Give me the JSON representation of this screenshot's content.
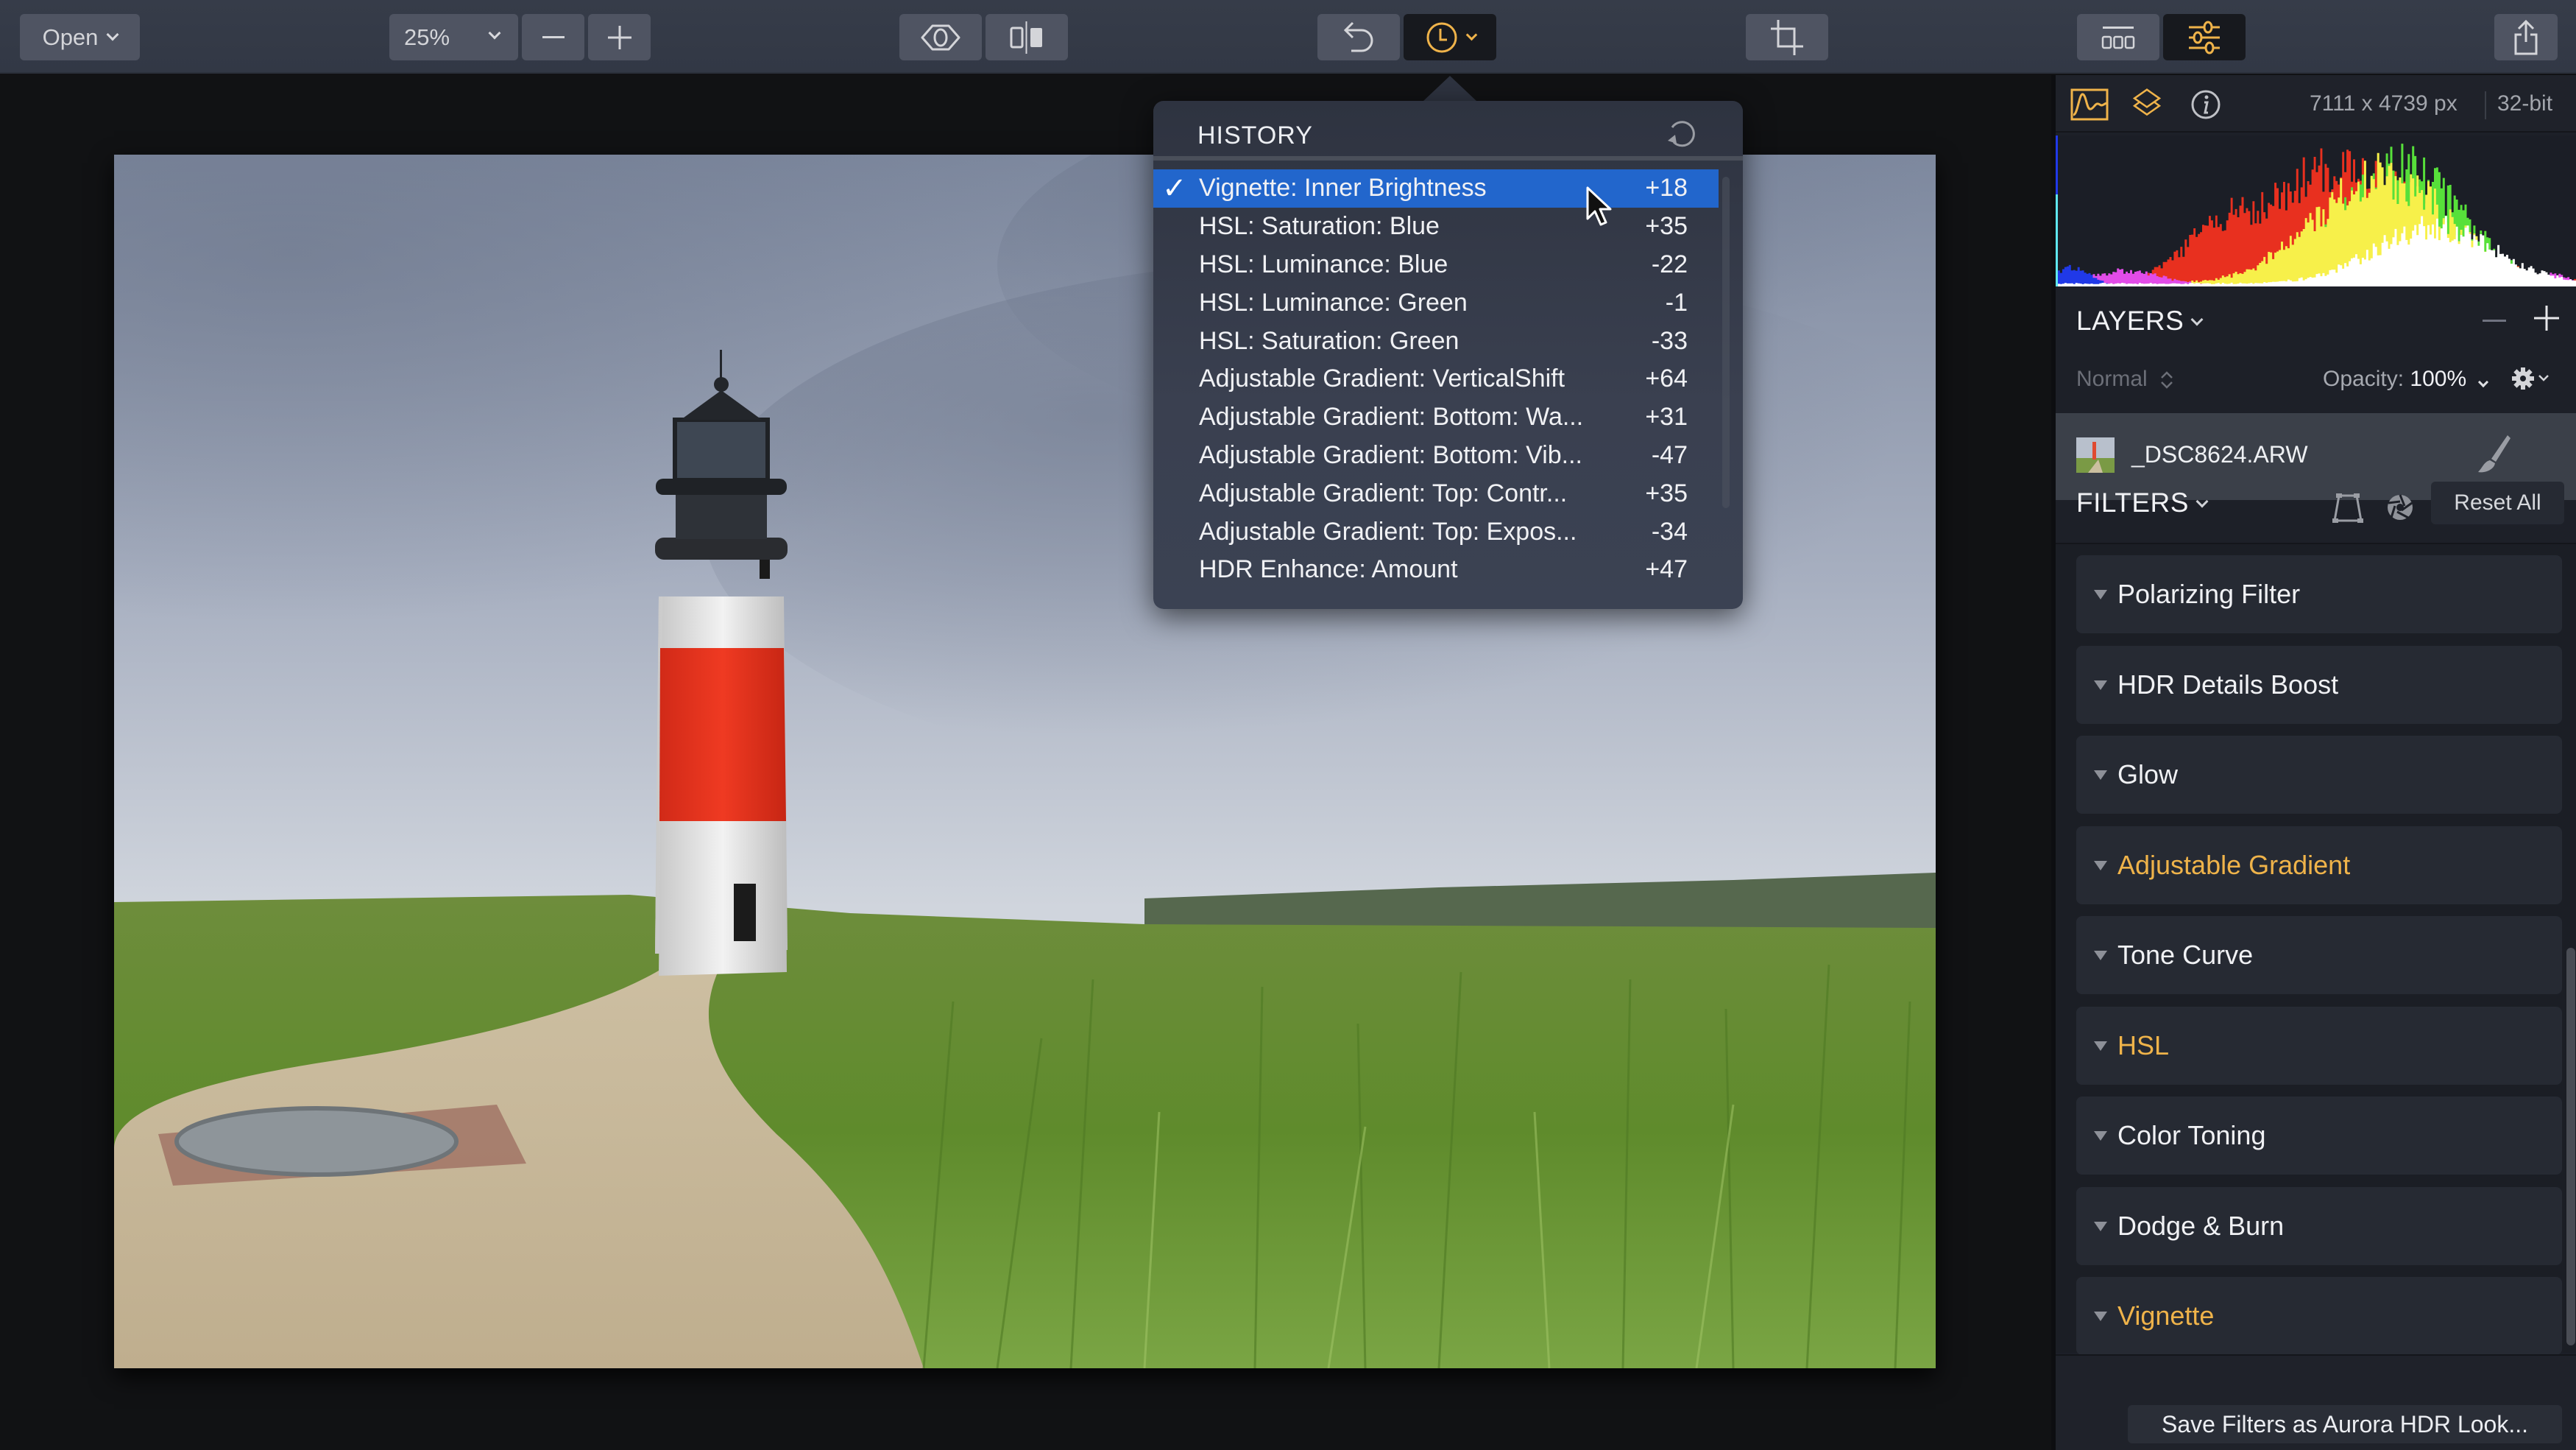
{
  "toolbar": {
    "open_label": "Open",
    "zoom_value": "25%",
    "zoom_out_icon": "minus-icon",
    "zoom_in_icon": "plus-icon",
    "preview_icon": "eye-icon",
    "compare_icon": "split-compare-icon",
    "undo_icon": "undo-icon",
    "history_icon": "clock-icon",
    "crop_icon": "crop-icon",
    "presets_icon": "presets-strip-icon",
    "adjust_icon": "sliders-icon",
    "share_icon": "share-icon"
  },
  "history": {
    "title": "HISTORY",
    "reset_icon": "reset-history-icon",
    "selected_index": 0,
    "items": [
      {
        "label": "Vignette: Inner Brightness",
        "value": "+18"
      },
      {
        "label": "HSL: Saturation: Blue",
        "value": "+35"
      },
      {
        "label": "HSL: Luminance: Blue",
        "value": "-22"
      },
      {
        "label": "HSL: Luminance: Green",
        "value": "-1"
      },
      {
        "label": "HSL: Saturation: Green",
        "value": "-33"
      },
      {
        "label": "Adjustable Gradient: VerticalShift",
        "value": "+64"
      },
      {
        "label": "Adjustable Gradient: Bottom: Wa...",
        "value": "+31"
      },
      {
        "label": "Adjustable Gradient: Bottom: Vib...",
        "value": "-47"
      },
      {
        "label": "Adjustable Gradient: Top: Contr...",
        "value": "+35"
      },
      {
        "label": "Adjustable Gradient: Top: Expos...",
        "value": "-34"
      },
      {
        "label": "HDR Enhance: Amount",
        "value": "+47"
      }
    ],
    "check_glyph": "✓"
  },
  "panel": {
    "tabs": [
      {
        "icon": "histogram-icon",
        "active": true
      },
      {
        "icon": "layers-icon",
        "active": true
      },
      {
        "icon": "info-icon",
        "active": false
      }
    ],
    "image_dimensions": "7111 x 4739 px",
    "bit_depth": "32-bit",
    "layers": {
      "title": "LAYERS",
      "blend_mode": "Normal",
      "opacity_label": "Opacity:",
      "opacity_value": "100%",
      "layer_name": "_DSC8624.ARW"
    },
    "filters": {
      "title": "FILTERS",
      "reset_all_label": "Reset All",
      "items": [
        {
          "name": "Polarizing Filter",
          "active": false
        },
        {
          "name": "HDR Details Boost",
          "active": false
        },
        {
          "name": "Glow",
          "active": false
        },
        {
          "name": "Adjustable Gradient",
          "active": true
        },
        {
          "name": "Tone Curve",
          "active": false
        },
        {
          "name": "HSL",
          "active": true
        },
        {
          "name": "Color Toning",
          "active": false
        },
        {
          "name": "Dodge & Burn",
          "active": false
        },
        {
          "name": "Vignette",
          "active": true
        }
      ]
    },
    "save_look_label": "Save Filters as Aurora HDR Look..."
  },
  "colors": {
    "accent": "#efb34a",
    "selection": "#2266cc",
    "toolbar_bg": "#343a47",
    "panel_bg": "#1d2028"
  }
}
